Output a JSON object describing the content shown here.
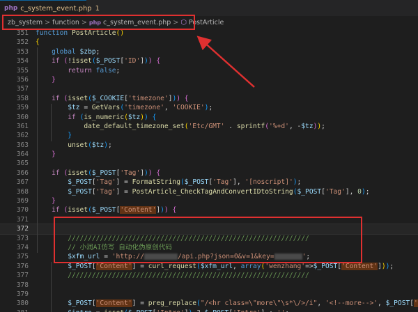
{
  "tab": {
    "icon": "php-icon",
    "icon_text": "php",
    "filename": "c_system_event.php",
    "problem_count": "1"
  },
  "breadcrumb": {
    "items": [
      "zb_system",
      "function",
      "c_system_event.php",
      "PostArticle"
    ],
    "separator": ">"
  },
  "editor": {
    "current_line": "372",
    "line_numbers": [
      "351",
      "352",
      "353",
      "354",
      "355",
      "356",
      "357",
      "358",
      "359",
      "360",
      "361",
      "362",
      "363",
      "364",
      "365",
      "366",
      "367",
      "368",
      "369",
      "370",
      "371",
      "372",
      "373",
      "374",
      "375",
      "376",
      "377",
      "378",
      "379",
      "380",
      "381",
      "382"
    ],
    "comment_rule": "////////////////////////////////////////////////////////////",
    "comment_text": "// 小润AI仿写 自动化伪原创代码"
  },
  "colors": {
    "keyword": "#569cd6",
    "control": "#c586c0",
    "function": "#dcdcaa",
    "variable": "#9cdcfe",
    "string": "#ce9178",
    "comment": "#6a9955",
    "annotation": "#e03030"
  }
}
